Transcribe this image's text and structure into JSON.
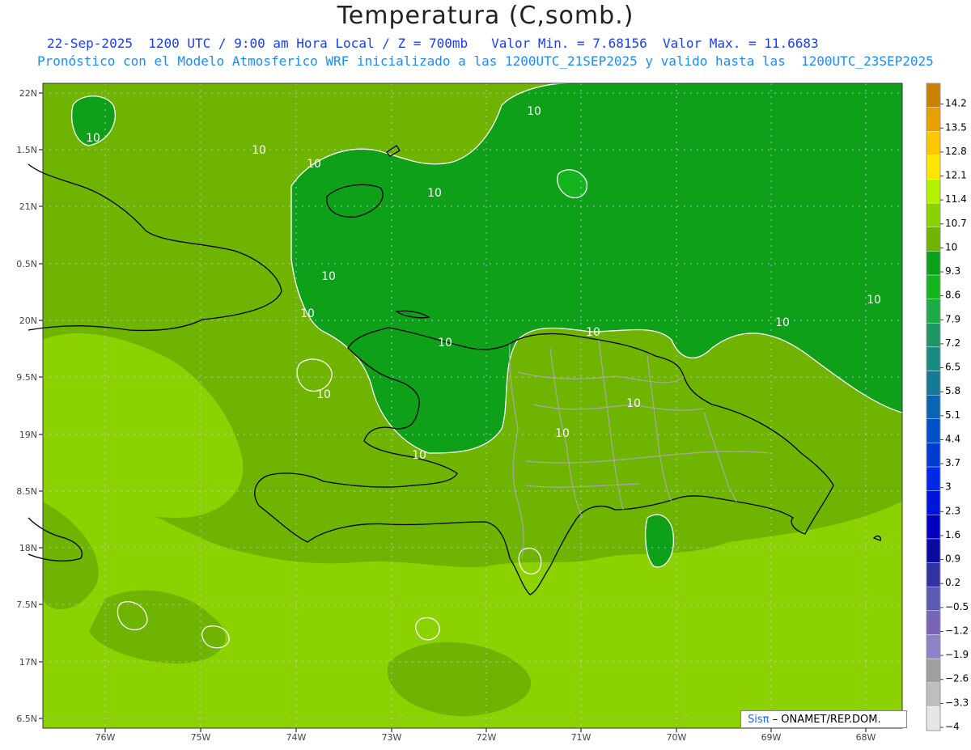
{
  "header": {
    "title": "Temperatura (C,somb.)",
    "line1": "22-Sep-2025  1200 UTC / 9:00 am Hora Local / Z = 700mb   Valor Min. = 7.68156  Valor Max. = 11.6683",
    "line2": "Pronóstico con el Modelo Atmosferico WRF inicializado a las 1200UTC_21SEP2025 y valido hasta las  1200UTC_23SEP2025"
  },
  "axes": {
    "lat_labels": [
      "22N",
      "1.5N",
      "21N",
      "0.5N",
      "20N",
      "9.5N",
      "19N",
      "8.5N",
      "18N",
      "7.5N",
      "17N",
      "6.5N"
    ],
    "lon_labels": [
      "76W",
      "75W",
      "74W",
      "73W",
      "72W",
      "71W",
      "70W",
      "69W",
      "68W"
    ]
  },
  "colorbar": {
    "labels": [
      "14.2",
      "13.5",
      "12.8",
      "12.1",
      "11.4",
      "10.7",
      "10",
      "9.3",
      "8.6",
      "7.9",
      "7.2",
      "6.5",
      "5.8",
      "5.1",
      "4.4",
      "3.7",
      "3",
      "2.3",
      "1.6",
      "0.9",
      "0.2",
      "−0.5",
      "−1.2",
      "−1.9",
      "−2.6",
      "−3.3",
      "−4"
    ],
    "colors": [
      "#c88200",
      "#e6a000",
      "#ffc800",
      "#ffe600",
      "#b4f000",
      "#8cd200",
      "#6eb400",
      "#0fa019",
      "#14b41e",
      "#1eaa46",
      "#1e9664",
      "#198c82",
      "#147896",
      "#0a64b4",
      "#0050c8",
      "#003cd2",
      "#0028e6",
      "#0014dc",
      "#0000be",
      "#0a0aa0",
      "#3232a0",
      "#5a5ab4",
      "#7864b4",
      "#8c82c8",
      "#a0a0a0",
      "#bebebe",
      "#e6e6e6"
    ]
  },
  "contour_labels": [
    "10",
    "10",
    "10",
    "10",
    "10",
    "10",
    "10",
    "10",
    "10",
    "10",
    "10",
    "10",
    "10",
    "10",
    "10"
  ],
  "credit": {
    "brand": "Sisπ",
    "text": "– ONAMET/REP.DOM."
  }
}
